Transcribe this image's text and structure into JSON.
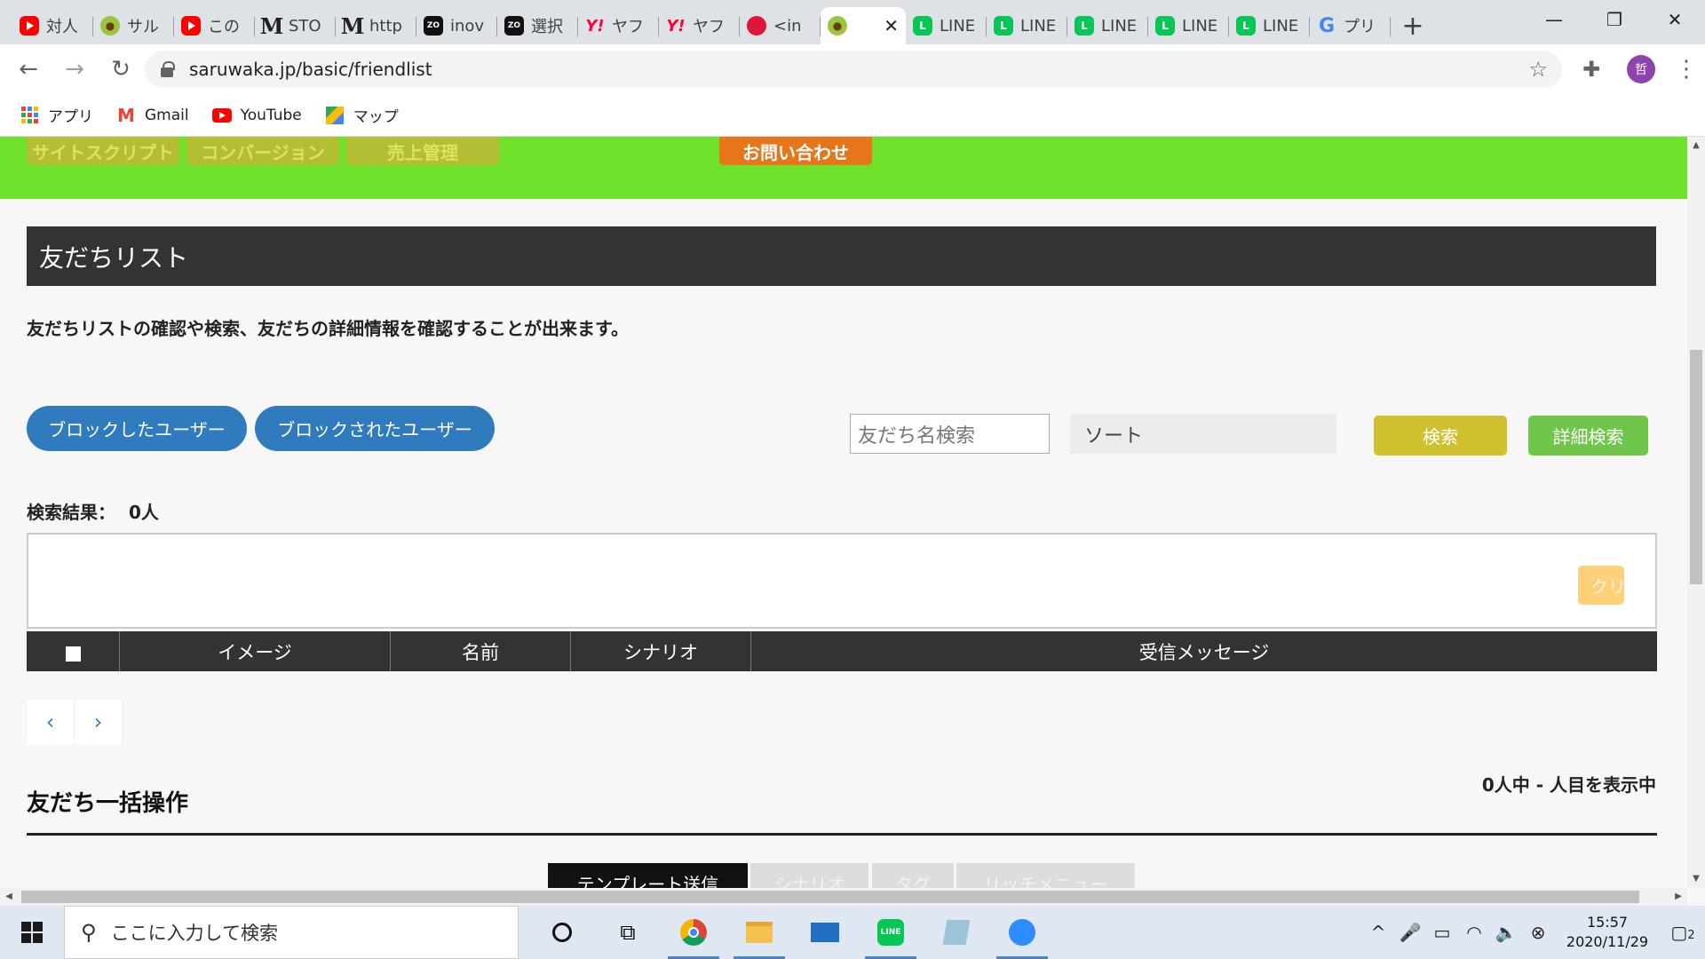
{
  "browser": {
    "tabs": [
      {
        "title": "対人",
        "icon": "youtube-icon",
        "type": "yt"
      },
      {
        "title": "サル",
        "icon": "monkey-icon",
        "type": "monkey"
      },
      {
        "title": "この",
        "icon": "youtube-icon",
        "type": "yt"
      },
      {
        "title": "STO",
        "icon": "m-logo-icon",
        "type": "m"
      },
      {
        "title": "http",
        "icon": "m-logo-icon",
        "type": "m"
      },
      {
        "title": "inov",
        "icon": "zozo-icon",
        "type": "zozo"
      },
      {
        "title": "選択",
        "icon": "zozo-icon",
        "type": "zozo"
      },
      {
        "title": "ヤフ",
        "icon": "yahoo-icon",
        "type": "yahoo"
      },
      {
        "title": "ヤフ",
        "icon": "yahoo-icon",
        "type": "yahoo"
      },
      {
        "title": "<in",
        "icon": "red-app-icon",
        "type": "red"
      },
      {
        "title": "",
        "icon": "monkey-icon",
        "type": "monkey",
        "active": true
      },
      {
        "title": "LINE",
        "icon": "line-icon",
        "type": "line"
      },
      {
        "title": "LINE",
        "icon": "line-icon",
        "type": "line"
      },
      {
        "title": "LINE",
        "icon": "line-icon",
        "type": "line"
      },
      {
        "title": "LINE",
        "icon": "line-icon",
        "type": "line"
      },
      {
        "title": "LINE",
        "icon": "line-icon",
        "type": "line"
      },
      {
        "title": "プリ",
        "icon": "google-icon",
        "type": "google"
      }
    ],
    "url": "saruwaka.jp/basic/friendlist",
    "avatar_initial": "哲",
    "bookmarks": [
      {
        "label": "アプリ",
        "icon": "apps-grid-icon"
      },
      {
        "label": "Gmail",
        "icon": "gmail-icon"
      },
      {
        "label": "YouTube",
        "icon": "youtube-icon"
      },
      {
        "label": "マップ",
        "icon": "maps-icon"
      }
    ]
  },
  "page": {
    "nav_buttons": [
      "サイトスクリプト",
      "コンバージョン",
      "売上管理",
      "お問い合わせ"
    ],
    "section_title": "友だちリスト",
    "description": "友だちリストの確認や検索、友だちの詳細情報を確認することが出来ます。",
    "blocked_users_button": "ブロックしたユーザー",
    "blocked_by_button": "ブロックされたユーザー",
    "search_placeholder": "友だち名検索",
    "sort_label": "ソート",
    "search_button": "検索",
    "detail_search_button": "詳細検索",
    "result_label": "検索結果：",
    "result_count": "0人",
    "clear_button": "クリ",
    "table_headers": [
      "イメージ",
      "名前",
      "シナリオ",
      "受信メッセージ"
    ],
    "pager_prev": "‹",
    "pager_next": "›",
    "showing_text": "0人中 - 人目を表示中",
    "bulk_title": "友だち一括操作",
    "bulk_tabs": [
      "テンプレート送信",
      "シナリオ",
      "タグ",
      "リッチメニュー"
    ]
  },
  "taskbar": {
    "search_placeholder": "ここに入力して検索",
    "time": "15:57",
    "date": "2020/11/29",
    "notifications": "2"
  },
  "colors": {
    "green_bar": "#6fe12a",
    "header_dark": "#333333",
    "pill_blue": "#2f7bbd",
    "search_yellow": "#cfc02f",
    "detail_green": "#6fc64a"
  }
}
